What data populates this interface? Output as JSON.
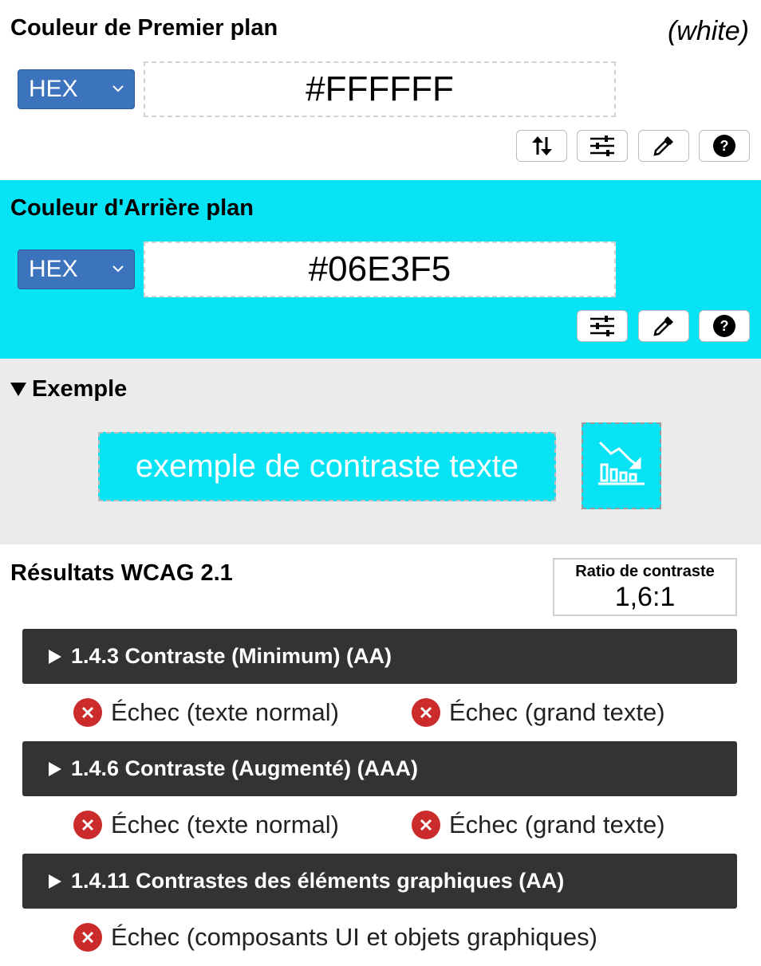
{
  "foreground": {
    "title": "Couleur de Premier plan",
    "color_name": "(white)",
    "format": "HEX",
    "value": "#FFFFFF",
    "tools": [
      "swap-icon",
      "sliders-icon",
      "eyedropper-icon",
      "help-icon"
    ]
  },
  "background": {
    "title": "Couleur d'Arrière plan",
    "format": "HEX",
    "value": "#06E3F5",
    "tools": [
      "sliders-icon",
      "eyedropper-icon",
      "help-icon"
    ]
  },
  "example": {
    "title": "Exemple",
    "sample_text": "exemple de contraste texte",
    "sample_icon": "chart-icon"
  },
  "results": {
    "title": "Résultats WCAG 2.1",
    "ratio_label": "Ratio de contraste",
    "ratio_value": "1,6:1",
    "criteria": [
      {
        "label": "1.4.3 Contraste (Minimum) (AA)",
        "results": [
          "Échec (texte normal)",
          "Échec (grand texte)"
        ]
      },
      {
        "label": "1.4.6 Contraste (Augmenté) (AAA)",
        "results": [
          "Échec (texte normal)",
          "Échec (grand texte)"
        ]
      },
      {
        "label": "1.4.11 Contrastes des éléments graphiques (AA)",
        "results": [
          "Échec (composants UI et objets graphiques)"
        ]
      }
    ]
  },
  "colors": {
    "foreground": "#FFFFFF",
    "background": "#06E3F5",
    "select_bg": "#3C73BD",
    "criterion_bg": "#333333",
    "fail": "#CC2B2B",
    "example_bg": "#EBEBEB"
  }
}
